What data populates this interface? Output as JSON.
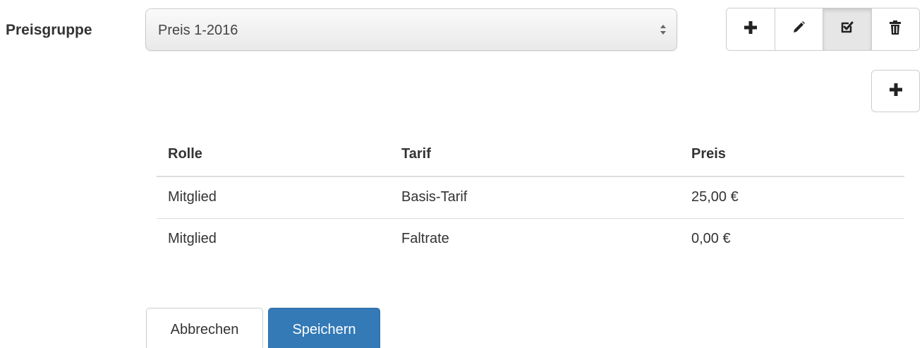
{
  "form": {
    "price_group_label": "Preisgruppe",
    "price_group_selected": "Preis 1-2016"
  },
  "toolbar": {
    "buttons": [
      {
        "icon": "plus-icon",
        "action": "add"
      },
      {
        "icon": "pencil-icon",
        "action": "edit"
      },
      {
        "icon": "checkbox-check-icon",
        "action": "select",
        "active": true
      },
      {
        "icon": "trash-icon",
        "action": "delete"
      }
    ],
    "add_row_icon": "plus-icon"
  },
  "table": {
    "headers": [
      "Rolle",
      "Tarif",
      "Preis"
    ],
    "rows": [
      [
        "Mitglied",
        "Basis-Tarif",
        "25,00 €"
      ],
      [
        "Mitglied",
        "Faltrate",
        "0,00 €"
      ]
    ]
  },
  "actions": {
    "cancel_label": "Abbrechen",
    "save_label": "Speichern"
  },
  "colors": {
    "primary": "#337ab7",
    "border": "#cccccc",
    "active_button_bg": "#e6e6e6"
  }
}
